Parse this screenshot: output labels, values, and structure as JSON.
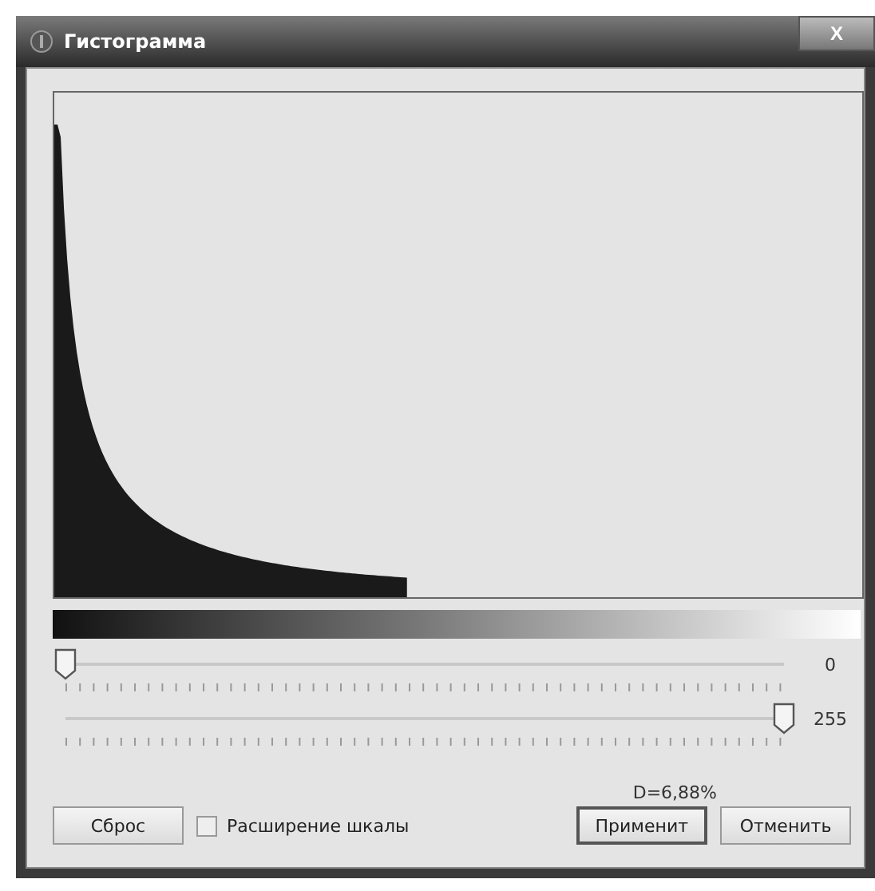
{
  "window": {
    "title": "Гистограмма",
    "close": "X"
  },
  "sliders": [
    {
      "level": 0,
      "reading": "0"
    },
    {
      "level": 1,
      "reading": "255"
    }
  ],
  "density": "D=6,88%",
  "reset_button": "Сброс",
  "scale_checkbox": {
    "label": "Расширение шкалы",
    "checked": false
  },
  "buttons": [
    {
      "label": "Применит",
      "default": true
    },
    {
      "label": "Отменить",
      "default": false
    }
  ]
}
